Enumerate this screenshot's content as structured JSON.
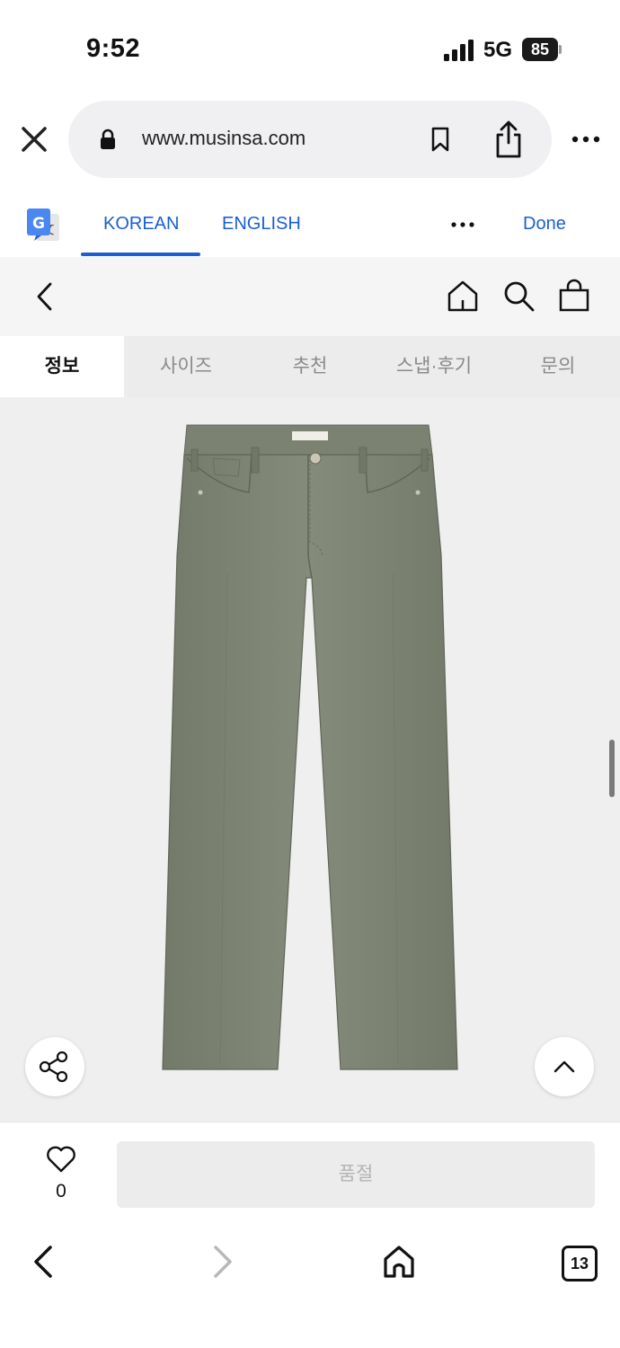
{
  "status": {
    "time": "9:52",
    "network": "5G",
    "battery": "85"
  },
  "browser": {
    "url": "www.musinsa.com",
    "tab_count": "13"
  },
  "translate": {
    "languages": [
      "KOREAN",
      "ENGLISH"
    ],
    "active_language": "KOREAN",
    "done_label": "Done"
  },
  "product": {
    "tabs": [
      "정보",
      "사이즈",
      "추천",
      "스냅·후기",
      "문의"
    ],
    "active_tab": "정보",
    "pants_color": "#7f8574"
  },
  "purchase": {
    "like_count": "0",
    "button_label": "품절"
  },
  "colors": {
    "accent": "#1a5fd1",
    "soldout_text": "#b3b3b3"
  }
}
